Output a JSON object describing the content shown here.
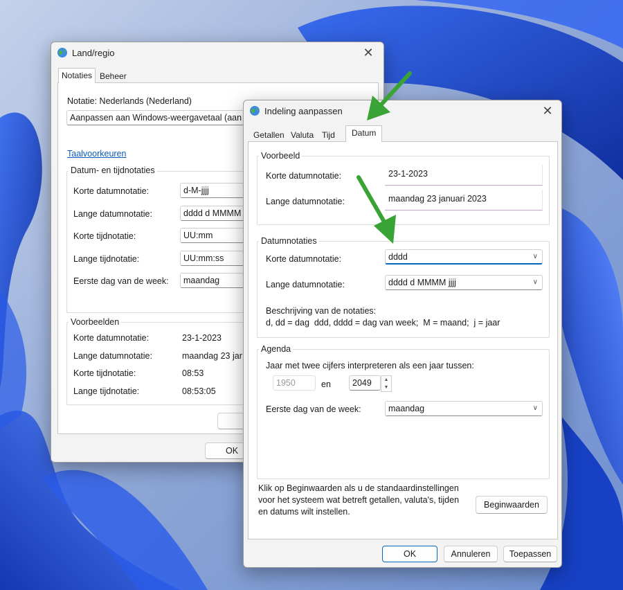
{
  "colors": {
    "wallpaper_bg": "#9fb3d6",
    "wallpaper_ribbon": "#1f4fd8",
    "accent": "#0067c0",
    "arrow": "#3aa335",
    "link": "#0a5cb8"
  },
  "region_dialog": {
    "title": "Land/regio",
    "icon": "globe-icon",
    "tabs": [
      "Notaties",
      "Beheer"
    ],
    "notation_label": "Notatie: Nederlands (Nederland)",
    "notation_select": "Aanpassen aan Windows-weergavetaal (aan",
    "language_prefs_link": "Taalvoorkeuren",
    "datetime_group": {
      "title": "Datum- en tijdnotaties",
      "rows": [
        {
          "label": "Korte datumnotatie:",
          "value": "d-M-jjjj"
        },
        {
          "label": "Lange datumnotatie:",
          "value": "dddd d MMMM"
        },
        {
          "label": "Korte tijdnotatie:",
          "value": "UU:mm"
        },
        {
          "label": "Lange tijdnotatie:",
          "value": "UU:mm:ss"
        },
        {
          "label": "Eerste dag van de week:",
          "value": "maandag"
        }
      ]
    },
    "examples_group": {
      "title": "Voorbeelden",
      "rows": [
        {
          "label": "Korte datumnotatie:",
          "value": "23-1-2023"
        },
        {
          "label": "Lange datumnotatie:",
          "value": "maandag 23 jar"
        },
        {
          "label": "Korte tijdnotatie:",
          "value": "08:53"
        },
        {
          "label": "Lange tijdnotatie:",
          "value": "08:53:05"
        }
      ]
    },
    "ok_label": "OK"
  },
  "format_dialog": {
    "title": "Indeling aanpassen",
    "icon": "globe-icon",
    "tabs": [
      "Getallen",
      "Valuta",
      "Tijd",
      "Datum"
    ],
    "active_tab": "Datum",
    "preview_group": {
      "title": "Voorbeeld",
      "short_label": "Korte datumnotatie:",
      "short_value": "23-1-2023",
      "long_label": "Lange datumnotatie:",
      "long_value": "maandag 23 januari 2023"
    },
    "formats_group": {
      "title": "Datumnotaties",
      "short_label": "Korte datumnotatie:",
      "short_value": "dddd",
      "long_label": "Lange datumnotatie:",
      "long_value": "dddd d MMMM jjjj",
      "desc_title": "Beschrijving van de notaties:",
      "desc_text": "d, dd = dag  ddd, dddd = dag van week;  M = maand;  j = jaar"
    },
    "agenda_group": {
      "title": "Agenda",
      "two_digit_label": "Jaar met twee cijfers interpreteren als een jaar tussen:",
      "year_from": "1950",
      "and_label": "en",
      "year_to": "2049",
      "first_day_label": "Eerste dag van de week:",
      "first_day_value": "maandag"
    },
    "reset_text_1": "Klik op Beginwaarden als u de standaardinstellingen",
    "reset_text_2": "voor het systeem wat betreft getallen, valuta's, tijden",
    "reset_text_3": "en datums wilt instellen.",
    "reset_button": "Beginwaarden",
    "ok_button": "OK",
    "cancel_button": "Annuleren",
    "apply_button": "Toepassen"
  }
}
